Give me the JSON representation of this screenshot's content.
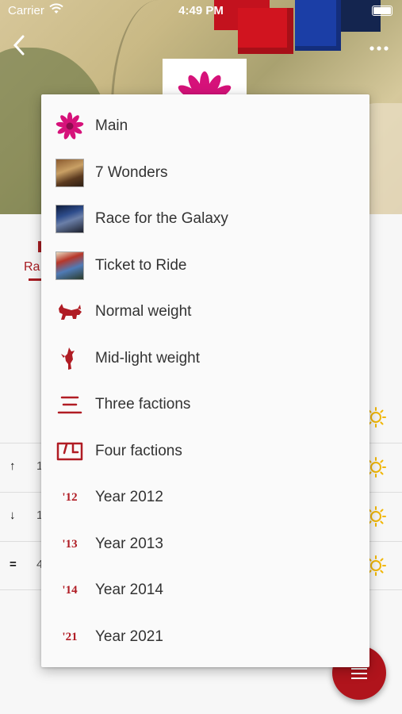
{
  "status_bar": {
    "carrier": "Carrier",
    "time": "4:49 PM"
  },
  "header": {
    "back_icon": "chevron-left-icon",
    "more_icon": "more-horizontal-icon"
  },
  "background": {
    "tab_label": "Ra",
    "rows": [
      {
        "glyph": "↑",
        "value": "1"
      },
      {
        "glyph": "↓",
        "value": "1"
      },
      {
        "glyph": "=",
        "value": "4"
      }
    ]
  },
  "menu": {
    "items": [
      {
        "label": "Main",
        "icon": "flower-icon"
      },
      {
        "label": "7 Wonders",
        "icon": "7-wonders-cover-icon"
      },
      {
        "label": "Race for the Galaxy",
        "icon": "race-for-the-galaxy-cover-icon"
      },
      {
        "label": "Ticket to Ride",
        "icon": "ticket-to-ride-cover-icon"
      },
      {
        "label": "Normal weight",
        "icon": "fox-icon"
      },
      {
        "label": "Mid-light weight",
        "icon": "bird-icon"
      },
      {
        "label": "Three factions",
        "icon": "kanji-three-icon",
        "glyph": "三"
      },
      {
        "label": "Four factions",
        "icon": "kanji-four-icon",
        "glyph": "四"
      },
      {
        "label": "Year 2012",
        "icon": "year-12-icon",
        "glyph": "'12"
      },
      {
        "label": "Year 2013",
        "icon": "year-13-icon",
        "glyph": "'13"
      },
      {
        "label": "Year 2014",
        "icon": "year-14-icon",
        "glyph": "'14"
      },
      {
        "label": "Year 2021",
        "icon": "year-21-icon",
        "glyph": "'21"
      }
    ]
  },
  "colors": {
    "accent": "#b0141c",
    "sun": "#f2b705",
    "menu_bg": "#fafafa",
    "text": "#333333"
  },
  "fab": {
    "icon": "menu-lines-icon"
  }
}
